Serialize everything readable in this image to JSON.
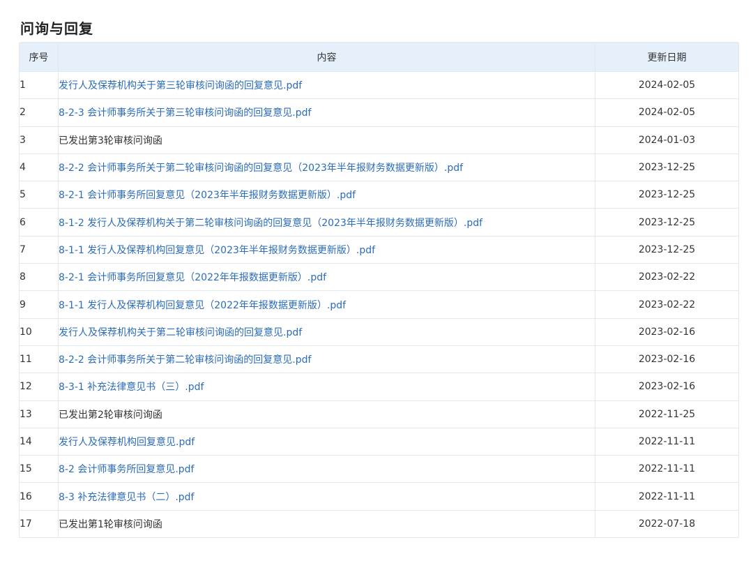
{
  "section": {
    "title": "问询与回复"
  },
  "table": {
    "headers": {
      "no": "序号",
      "content": "内容",
      "date": "更新日期"
    },
    "rows": [
      {
        "no": "1",
        "content": "发行人及保荐机构关于第三轮审核问询函的回复意见.pdf",
        "link": true,
        "date": "2024-02-05"
      },
      {
        "no": "2",
        "content": "8-2-3 会计师事务所关于第三轮审核问询函的回复意见.pdf",
        "link": true,
        "date": "2024-02-05"
      },
      {
        "no": "3",
        "content": "已发出第3轮审核问询函",
        "link": false,
        "date": "2024-01-03"
      },
      {
        "no": "4",
        "content": "8-2-2 会计师事务所关于第二轮审核问询函的回复意见（2023年半年报财务数据更新版）.pdf",
        "link": true,
        "date": "2023-12-25"
      },
      {
        "no": "5",
        "content": "8-2-1 会计师事务所回复意见（2023年半年报财务数据更新版）.pdf",
        "link": true,
        "date": "2023-12-25"
      },
      {
        "no": "6",
        "content": "8-1-2 发行人及保荐机构关于第二轮审核问询函的回复意见（2023年半年报财务数据更新版）.pdf",
        "link": true,
        "date": "2023-12-25"
      },
      {
        "no": "7",
        "content": "8-1-1 发行人及保荐机构回复意见（2023年半年报财务数据更新版）.pdf",
        "link": true,
        "date": "2023-12-25"
      },
      {
        "no": "8",
        "content": "8-2-1 会计师事务所回复意见（2022年年报数据更新版）.pdf",
        "link": true,
        "date": "2023-02-22"
      },
      {
        "no": "9",
        "content": "8-1-1 发行人及保荐机构回复意见（2022年年报数据更新版）.pdf",
        "link": true,
        "date": "2023-02-22"
      },
      {
        "no": "10",
        "content": "发行人及保荐机构关于第二轮审核问询函的回复意见.pdf",
        "link": true,
        "date": "2023-02-16"
      },
      {
        "no": "11",
        "content": "8-2-2 会计师事务所关于第二轮审核问询函的回复意见.pdf",
        "link": true,
        "date": "2023-02-16"
      },
      {
        "no": "12",
        "content": "8-3-1 补充法律意见书（三）.pdf",
        "link": true,
        "date": "2023-02-16"
      },
      {
        "no": "13",
        "content": "已发出第2轮审核问询函",
        "link": false,
        "date": "2022-11-25"
      },
      {
        "no": "14",
        "content": "发行人及保荐机构回复意见.pdf",
        "link": true,
        "date": "2022-11-11"
      },
      {
        "no": "15",
        "content": "8-2 会计师事务所回复意见.pdf",
        "link": true,
        "date": "2022-11-11"
      },
      {
        "no": "16",
        "content": "8-3 补充法律意见书（二）.pdf",
        "link": true,
        "date": "2022-11-11"
      },
      {
        "no": "17",
        "content": "已发出第1轮审核问询函",
        "link": false,
        "date": "2022-07-18"
      }
    ]
  },
  "colors": {
    "link": "#2b6cb8",
    "header_bg": "#e6f0fa",
    "border": "#e3e8ee",
    "text": "#333333"
  }
}
